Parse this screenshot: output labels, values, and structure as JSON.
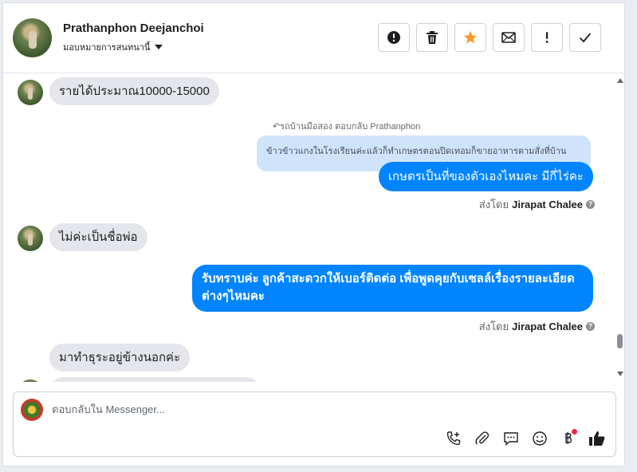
{
  "contact": {
    "name": "Prathanphon Deejanchoi",
    "assign_label": "มอบหมายการสนทนานี้"
  },
  "actions": [
    {
      "name": "report-spam-button",
      "icon": "alert-circle-icon"
    },
    {
      "name": "delete-button",
      "icon": "trash-icon"
    },
    {
      "name": "star-button",
      "icon": "star-icon",
      "color": "#f79b2e"
    },
    {
      "name": "mark-unread-button",
      "icon": "envelope-icon"
    },
    {
      "name": "follow-up-button",
      "icon": "exclamation-icon"
    },
    {
      "name": "mark-done-button",
      "icon": "check-icon"
    }
  ],
  "messages": {
    "m1": "รายได้ประมาณ10000-15000",
    "reply_context": "รถบ้านมือสอง ตอบกลับ Prathanphon",
    "quoted": "ข้าวข้าวแกงในโรงเรียนค่ะแล้วก็ทำเกษตรตอนปิดเทอมก็ขายอาหารตามสั่งที่บ้าน",
    "m2": "เกษตรเป็นที่ของตัวเองไหมคะ มีกี่ไร่คะ",
    "sent_by_1": "ส่งโดย",
    "sender_1": "Jirapat Chalee",
    "m3": "ไม่ค่ะเป็นชื่อพ่อ",
    "m4_line1": "รับทราบค่ะ ลูกค้าสะดวกให้เบอร์ติดต่อ เพื่อพูดคุยกับเซลล์เรื่องรายละเอียด",
    "m4_line2": "ต่างๆไหมคะ",
    "sent_by_2": "ส่งโดย",
    "sender_2": "Jirapat Chalee",
    "m5": "มาทำธุระอยู่ข้างนอกค่ะ"
  },
  "composer": {
    "placeholder": "ตอบกลับใน Messenger..."
  },
  "colors": {
    "outgoing": "#0084ff",
    "incoming": "#e4e6eb",
    "quoted": "#cfe4fb"
  }
}
